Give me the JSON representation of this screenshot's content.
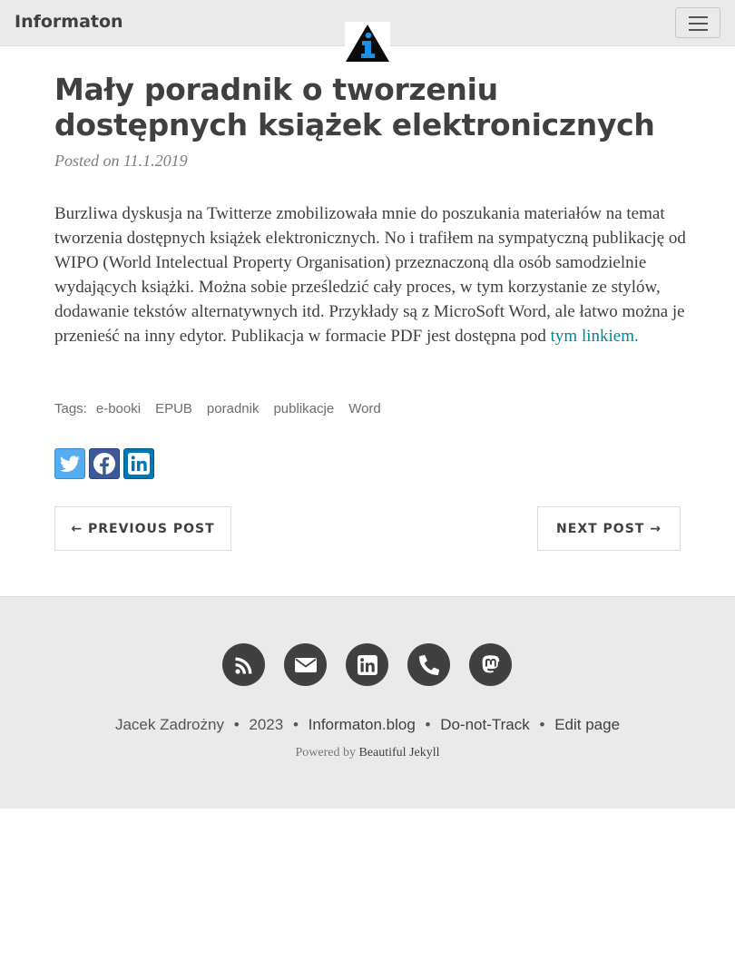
{
  "nav": {
    "brand": "Informaton",
    "menu_toggle": "toggle-navigation"
  },
  "post": {
    "title": "Mały poradnik o tworzeniu dostępnych książek elektronicznych",
    "meta": "Posted on 11.1.2019",
    "body_text": "Burzliwa dyskusja na Twitterze zmobilizowała mnie do poszukania materiałów na temat tworzenia dostępnych książek elektronicznych. No i trafiłem na sympatyczną publikację od WIPO (World Intelectual Property Organisation) przeznaczoną dla osób samodzielnie wydających książki. Można sobie prześledzić cały proces, w tym korzystanie ze stylów, dodawanie tekstów alternatywnych itd. Przykłady są z MicroSoft Word, ale łatwo można je przenieść na inny edytor. Publikacja w formacie PDF jest dostępna pod",
    "link_text": "tym linkiem."
  },
  "tags": {
    "label": "Tags:",
    "items": [
      "e-booki",
      "EPUB",
      "poradnik",
      "publikacje",
      "Word"
    ]
  },
  "share": {
    "icons": [
      "twitter-icon",
      "facebook-icon",
      "linkedin-icon"
    ]
  },
  "pager": {
    "previous": "← PREVIOUS POST",
    "next": "NEXT POST →"
  },
  "footer": {
    "icons": [
      "rss-icon",
      "envelope-icon",
      "linkedin-icon",
      "phone-icon",
      "mastodon-icon"
    ],
    "author": "Jacek Zadrożny",
    "year": "2023",
    "site": "Informaton.blog",
    "dnt": "Do-not-Track",
    "edit": "Edit page",
    "powered_prefix": "Powered by",
    "powered_link": "Beautiful Jekyll",
    "separator": "•"
  },
  "colors": {
    "link": "#0085a1",
    "text": "#404040",
    "footer_bg": "#eaeaea",
    "twitter": "#55acee",
    "facebook": "#3b5998",
    "linkedin": "#0077b5"
  }
}
